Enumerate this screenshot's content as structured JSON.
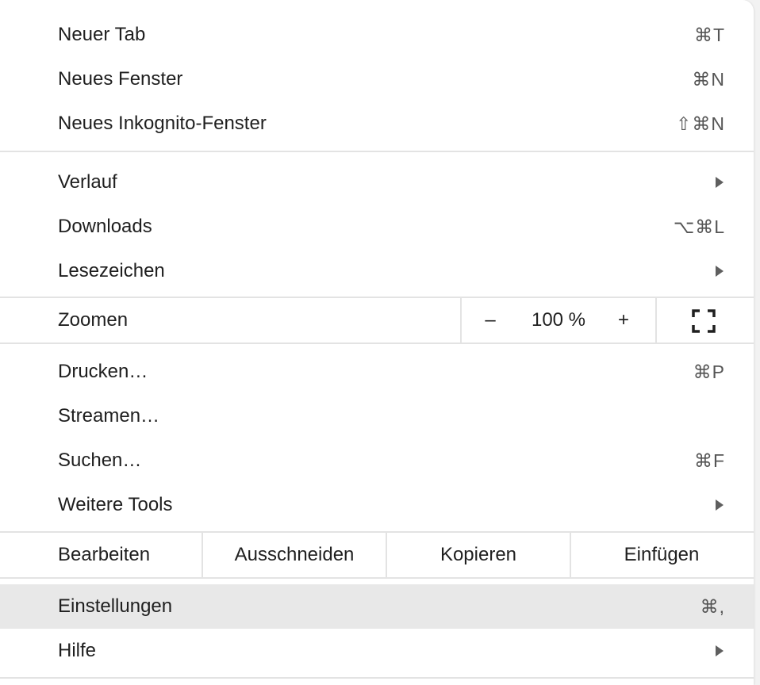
{
  "menu": {
    "items_top": [
      {
        "label": "Neuer Tab",
        "shortcut": "⌘T"
      },
      {
        "label": "Neues Fenster",
        "shortcut": "⌘N"
      },
      {
        "label": "Neues Inkognito-Fenster",
        "shortcut": "⇧⌘N"
      }
    ],
    "items_nav": [
      {
        "label": "Verlauf",
        "submenu": true
      },
      {
        "label": "Downloads",
        "shortcut": "⌥⌘L"
      },
      {
        "label": "Lesezeichen",
        "submenu": true
      }
    ],
    "zoom": {
      "label": "Zoomen",
      "minus": "–",
      "value": "100 %",
      "plus": "+",
      "fullscreen_icon": "fullscreen-icon"
    },
    "items_tools": [
      {
        "label": "Drucken…",
        "shortcut": "⌘P"
      },
      {
        "label": "Streamen…"
      },
      {
        "label": "Suchen…",
        "shortcut": "⌘F"
      },
      {
        "label": "Weitere Tools",
        "submenu": true
      }
    ],
    "edit": {
      "label": "Bearbeiten",
      "cut": "Ausschneiden",
      "copy": "Kopieren",
      "paste": "Einfügen"
    },
    "items_bottom": [
      {
        "label": "Einstellungen",
        "shortcut": "⌘,",
        "highlighted": true
      },
      {
        "label": "Hilfe",
        "submenu": true
      }
    ],
    "colors": {
      "background": "#ffffff",
      "highlight": "#e8e8e8",
      "divider": "#e3e3e3",
      "text": "#1f1f1f",
      "shortcut": "#555555"
    }
  }
}
